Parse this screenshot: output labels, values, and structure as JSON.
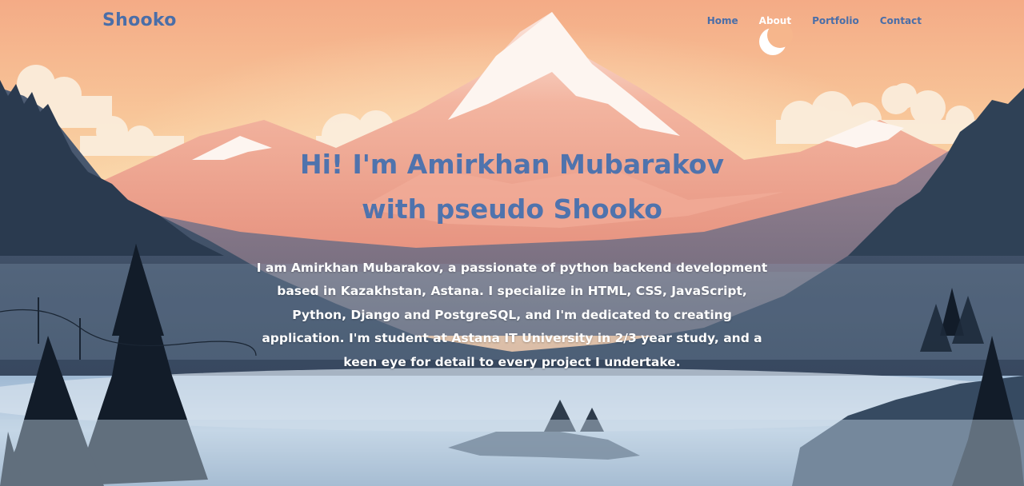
{
  "brand": {
    "name": "Shooko",
    "color": "#4a6ea8"
  },
  "nav": {
    "items": [
      {
        "label": "Home",
        "color": "#4a6ea8"
      },
      {
        "label": "About",
        "color": "#ffffff"
      },
      {
        "label": "Portfolio",
        "color": "#4a6ea8"
      },
      {
        "label": "Contact",
        "color": "#4a6ea8"
      }
    ]
  },
  "hero": {
    "title_line1": "Hi! I'm Amirkhan Mubarakov",
    "title_line2": "with pseudo Shooko",
    "bio": "I am Amirkhan Mubarakov, a passionate of python backend development based in Kazakhstan, Astana. I specialize in HTML, CSS, JavaScript, Python, Django and PostgreSQL, and I'm dedicated to creating application. I'm student at Astana IT University in 2/3 year study, and a keen eye for detail to every project I undertake."
  },
  "colors": {
    "sky_top": "#f6b98d",
    "sky_mid": "#f9d7a8",
    "accent_blue": "#4f73ad",
    "forest_dark": "#1e2c3c",
    "mist": "#b9cde0"
  }
}
